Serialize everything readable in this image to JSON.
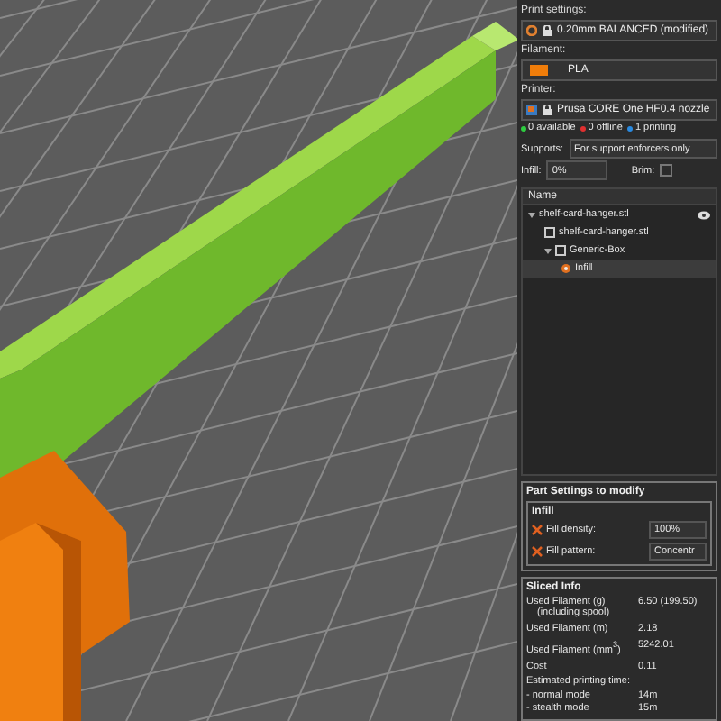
{
  "print_settings": {
    "label": "Print settings:",
    "value": "0.20mm BALANCED (modified)"
  },
  "filament": {
    "label": "Filament:",
    "color": "#f07d0a",
    "value": "PLA"
  },
  "printer": {
    "label": "Printer:",
    "value": "Prusa CORE One HF0.4 nozzle"
  },
  "printer_status": [
    {
      "text": "0 available",
      "color": "#2ecc40"
    },
    {
      "text": "0 offline",
      "color": "#e03030"
    },
    {
      "text": "1 printing",
      "color": "#2a8ae0"
    }
  ],
  "supports": {
    "label": "Supports:",
    "value": "For support enforcers only"
  },
  "infill": {
    "label": "Infill:",
    "value": "0%"
  },
  "brim": {
    "label": "Brim:",
    "checked": false
  },
  "object_list": {
    "column": "Name",
    "items": [
      {
        "name": "shelf-card-hanger.stl",
        "kind": "object",
        "expanded": true,
        "selected": false,
        "children": [
          {
            "name": "shelf-card-hanger.stl",
            "kind": "part",
            "selected": false
          },
          {
            "name": "Generic-Box",
            "kind": "part",
            "expanded": true,
            "selected": false,
            "children": [
              {
                "name": "Infill",
                "kind": "setting",
                "selected": true
              }
            ]
          }
        ]
      }
    ]
  },
  "part_settings": {
    "title": "Part Settings to modify",
    "group": "Infill",
    "rows": [
      {
        "label": "Fill density:",
        "value": "100%"
      },
      {
        "label": "Fill pattern:",
        "value": "Concentr"
      }
    ]
  },
  "sliced_info": {
    "title": "Sliced Info",
    "rows": [
      {
        "label": "Used Filament (g)",
        "sub": "(including spool)",
        "value": "6.50 (199.50)"
      },
      {
        "label": "Used Filament (m)",
        "value": "2.18"
      },
      {
        "label": "Used Filament (mm$^{3}$)",
        "value": "5242.01"
      },
      {
        "label": "Cost",
        "value": "0.11"
      }
    ],
    "time_title": "Estimated printing time:",
    "times": [
      {
        "label": "- normal mode",
        "value": "14m"
      },
      {
        "label": "- stealth mode",
        "value": "15m"
      }
    ]
  }
}
